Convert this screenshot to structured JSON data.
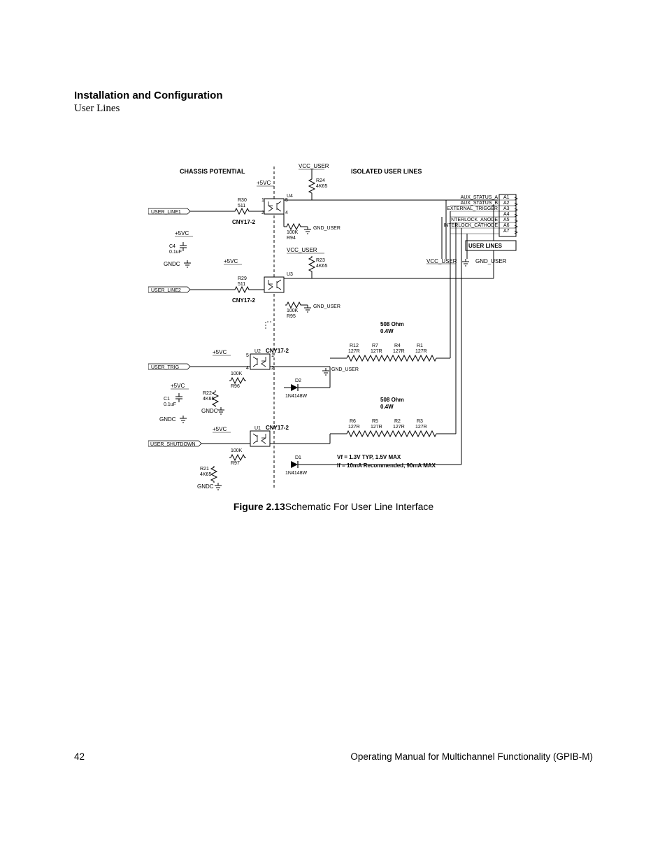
{
  "header": {
    "section_title": "Installation and Configuration",
    "section_sub": "User Lines"
  },
  "caption": {
    "label": "Figure 2.13",
    "text": "Schematic For User Line Interface"
  },
  "footer": {
    "page_number": "42",
    "manual_title": "Operating Manual for Multichannel Functionality (GPIB-M)"
  },
  "schematic": {
    "title_left": "CHASSIS POTENTIAL",
    "title_right": "ISOLATED USER LINES",
    "user_lines_box": "USER LINES",
    "vcc_user": "VCC_USER",
    "gnd_user": "GND_USER",
    "plus5vc": "+5VC",
    "gndc": "GNDC",
    "opto": "CNY17-2",
    "diode": "1N4148W",
    "vf_note": "Vf = 1.3V TYP, 1.5V MAX",
    "if_note": "If = 10mA Recommended, 90mA MAX",
    "ohm_note1": "508 Ohm",
    "ohm_note2": "0.4W",
    "inputs": {
      "user_line1": "USER_LINE1",
      "user_line2": "USER_LINE2",
      "user_trig": "USER_TRIG",
      "user_shutdown": "USER_SHUTDOWN"
    },
    "pins": {
      "a1": "A1",
      "a2": "A2",
      "a3": "A3",
      "a4": "A4",
      "a5": "A5",
      "a6": "A6",
      "a7": "A7",
      "aux_status_a": "AUX_STATUS_A",
      "aux_status_b": "AUX_STATUS_B",
      "external_trigger": "EXTERNAL_TRIGGER",
      "interlock_anode": "INTERLOCK_ANODE",
      "interlock_cathode": "INTERLOCK_CATHODE"
    },
    "components": {
      "r24": "R24",
      "r24v": "4K65",
      "r23": "R23",
      "r23v": "4K65",
      "r30": "R30",
      "r30v": "511",
      "r29": "R29",
      "r29v": "511",
      "r94": "R94",
      "r94v": "100K",
      "r95": "R95",
      "r95v": "100K",
      "r96": "R96",
      "r96v": "100K",
      "r97": "R97",
      "r97v": "100K",
      "r22": "R22",
      "r22v": "4K65",
      "r21": "R21",
      "r21v": "4K65",
      "c4": "C4",
      "c4v": "0.1uF",
      "c1": "C1",
      "c1v": "0.1uF",
      "u1": "U1",
      "u2": "U2",
      "u3": "U3",
      "u4": "U4",
      "d1": "D1",
      "d2": "D2",
      "r12": "R12",
      "r7": "R7",
      "r4": "R4",
      "r1": "R1",
      "r6": "R6",
      "r5": "R5",
      "r2": "R2",
      "r3": "R3",
      "r127": "127R"
    }
  }
}
